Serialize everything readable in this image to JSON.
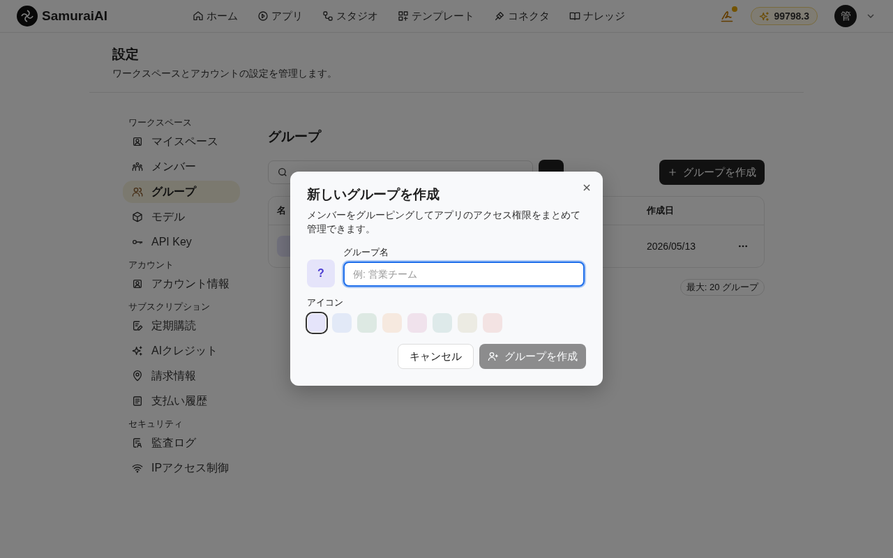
{
  "header": {
    "brand": "SamuraiAI",
    "nav": [
      {
        "label": "ホーム"
      },
      {
        "label": "アプリ"
      },
      {
        "label": "スタジオ"
      },
      {
        "label": "テンプレート"
      },
      {
        "label": "コネクタ"
      },
      {
        "label": "ナレッジ"
      }
    ],
    "notification": true,
    "credits": "99798.3",
    "avatar": "管"
  },
  "page": {
    "title": "設定",
    "subtitle": "ワークスペースとアカウントの設定を管理します。"
  },
  "sidebar": {
    "sections": [
      {
        "heading": "ワークスペース",
        "items": [
          {
            "label": "マイスペース",
            "selected": false
          },
          {
            "label": "メンバー",
            "selected": false
          },
          {
            "label": "グループ",
            "selected": true
          },
          {
            "label": "モデル",
            "selected": false
          },
          {
            "label": "API Key",
            "selected": false
          }
        ]
      },
      {
        "heading": "アカウント",
        "items": [
          {
            "label": "アカウント情報",
            "selected": false
          }
        ]
      },
      {
        "heading": "サブスクリプション",
        "items": [
          {
            "label": "定期購読",
            "selected": false
          },
          {
            "label": "AIクレジット",
            "selected": false
          },
          {
            "label": "請求情報",
            "selected": false
          },
          {
            "label": "支払い履歴",
            "selected": false
          }
        ]
      },
      {
        "heading": "セキュリティ",
        "items": [
          {
            "label": "監査ログ",
            "selected": false
          },
          {
            "label": "IPアクセス制御",
            "selected": false
          }
        ]
      }
    ]
  },
  "groups": {
    "title": "グループ",
    "create_button": "グループを作成",
    "table": {
      "columns": [
        "名",
        "作成日"
      ],
      "rows": [
        {
          "created": "2026/05/13"
        }
      ]
    },
    "limit": "最大: 20 グループ"
  },
  "dialog": {
    "title": "新しいグループを作成",
    "description": "メンバーをグルーピングしてアプリのアクセス権限をまとめて管理できます。",
    "preview": "?",
    "field_label": "グループ名",
    "placeholder": "例: 営業チーム",
    "icon_label": "アイコン",
    "swatches": [
      {
        "color": "#e5e4fa",
        "selected": true
      },
      {
        "color": "#e2e9f7",
        "selected": false
      },
      {
        "color": "#dde9e3",
        "selected": false
      },
      {
        "color": "#f6e9df",
        "selected": false
      },
      {
        "color": "#f0e2ec",
        "selected": false
      },
      {
        "color": "#deeaea",
        "selected": false
      },
      {
        "color": "#ecebe3",
        "selected": false
      },
      {
        "color": "#f3e3e3",
        "selected": false
      }
    ],
    "buttons": [
      {
        "label": "キャンセル",
        "kind": "secondary",
        "disabled": false
      },
      {
        "label": "グループを作成",
        "kind": "primary",
        "disabled": true
      }
    ]
  }
}
